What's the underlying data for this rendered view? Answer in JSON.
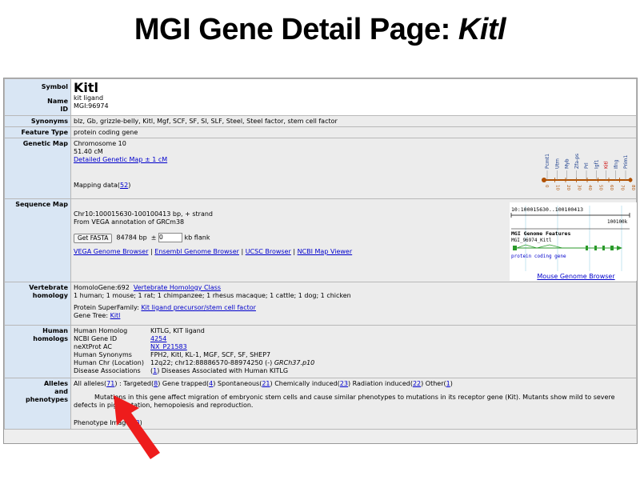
{
  "slide": {
    "title_plain": "MGI Gene Detail Page: ",
    "title_italic": "Kitl"
  },
  "symbol": {
    "label_symbol": "Symbol",
    "label_name": "Name",
    "label_id": "ID",
    "symbol": "Kitl",
    "name": "kit ligand",
    "id": "MGI:96974"
  },
  "synonyms": {
    "label": "Synonyms",
    "value": "blz, Gb, grizzle-belly, Kitl, Mgf, SCF, SF, Sl, SLF, Steel, Steel factor, stem cell factor"
  },
  "feature": {
    "label": "Feature Type",
    "value": "protein coding gene"
  },
  "genetic_map": {
    "label": "Genetic Map",
    "chromosome": "Chromosome 10",
    "cm": "51.40 cM",
    "detailed_link": "Detailed Genetic Map ± 1 cM",
    "mapping_prefix": "Mapping data(",
    "mapping_count": "52",
    "mapping_suffix": ")",
    "genes": [
      "Pcmt1",
      "Utrn",
      "Myb",
      "Zfa-ps",
      "Prl",
      "Igf1",
      "Kitl",
      "Ifng",
      "Prim1"
    ],
    "ticks": [
      "0",
      "10",
      "20",
      "30",
      "40",
      "50",
      "60",
      "70",
      "80"
    ],
    "colors": {
      "line": "#b05000",
      "highlight": "#cc0000"
    }
  },
  "sequence_map": {
    "label": "Sequence Map",
    "coords": "Chr10:100015630-100100413 bp, + strand",
    "source": "From VEGA annotation of GRCm38",
    "fasta_button": "Get FASTA",
    "bp_text": "84784 bp",
    "pm": "±",
    "flank_value": "0",
    "flank_label": "kb flank",
    "links": [
      "VEGA Genome Browser",
      "Ensembl Genome Browser",
      "UCSC Browser",
      "NCBI Map Viewer"
    ],
    "viewer": {
      "range": "10:100015630..100100413",
      "scale": "100100k",
      "track_title": "MGI Genome Features",
      "feature_id": "MGI_96974_Kitl",
      "feature_type": "protein coding gene",
      "browser_link": "Mouse Genome Browser"
    }
  },
  "vertebrate": {
    "label1": "Vertebrate",
    "label2": "homology",
    "homologene": "HomoloGene:692",
    "class_link": "Vertebrate Homology Class",
    "species": "1 human; 1 mouse; 1 rat; 1 chimpanzee; 1 rhesus macaque; 1 cattle; 1 dog; 1 chicken",
    "superfamily_label": "Protein SuperFamily:",
    "superfamily_link": "Kit ligand precursor/stem cell factor",
    "genetree_label": "Gene Tree:",
    "genetree_link": "Kitl"
  },
  "human": {
    "label1": "Human",
    "label2": "homologs",
    "rows": [
      {
        "k": "Human Homolog",
        "v": "KITLG, KIT ligand"
      },
      {
        "k": "NCBI Gene ID",
        "v": "4254",
        "link": true
      },
      {
        "k": "neXtProt AC",
        "v": "NX_P21583",
        "link": true
      },
      {
        "k": "Human Synonyms",
        "v": "FPH2, Kitl, KL-1, MGF, SCF, SF, SHEP7"
      },
      {
        "k": "Human Chr (Location)",
        "v": "12q22; chr12:88886570-88974250 (-)",
        "italic": "GRCh37.p10"
      }
    ],
    "disease_label": "Disease Associations",
    "disease_count": "1",
    "disease_text": "Diseases Associated with Human KITLG"
  },
  "alleles": {
    "label1": "Alleles",
    "label2": "and",
    "label3": "phenotypes",
    "all_label": "All alleles(",
    "all_count": "71",
    "targeted_label": ") : Targeted(",
    "targeted_count": "8",
    "trapped_label": ") Gene trapped(",
    "trapped_count": "4",
    "spont_label": ") Spontaneous(",
    "spont_count": "21",
    "chem_label": ") Chemically induced(",
    "chem_count": "23",
    "rad_label": ") Radiation induced(",
    "rad_count": "22",
    "other_label": ") Other(",
    "other_count": "1",
    "close": ")",
    "mutation_line1": "Mutations in this gene affect migration of embryonic stem cells and cause similar phenotypes to mutations in its receptor gene (Kit). Mutants show mild to severe",
    "mutation_line2": "defects in pigmentation, hemopoiesis and reproduction.",
    "images_label": "Phenotype Images(",
    "images_count": "8",
    "images_close": ")"
  },
  "arrow_color": "#ee1c1c"
}
